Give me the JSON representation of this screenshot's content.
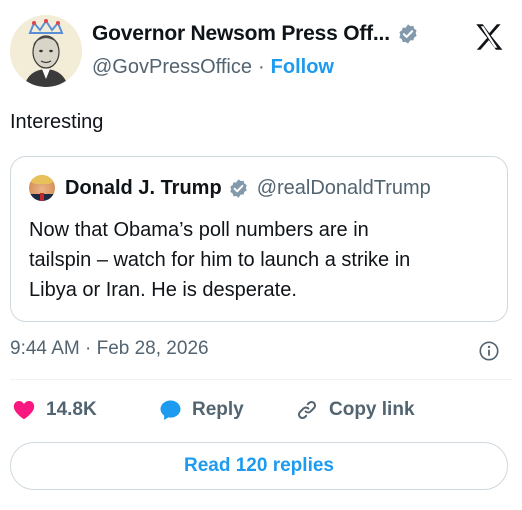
{
  "author": {
    "name": "Governor Newsom Press Off...",
    "handle": "@GovPressOffice",
    "separator": "·",
    "follow_label": "Follow"
  },
  "tweet": {
    "text": "Interesting",
    "timestamp": "9:44 AM · Feb 28, 2026"
  },
  "quoted_tweet": {
    "name": "Donald J. Trump",
    "handle": "@realDonaldTrump",
    "text": "Now that Obama’s poll numbers are in\ntailspin – watch for him to launch a strike in\nLibya or Iran.  He is desperate."
  },
  "actions": {
    "like_count": "14.8K",
    "reply_label": "Reply",
    "copy_link_label": "Copy link",
    "read_replies_label": "Read 120 replies"
  },
  "icons": {
    "verified": "verified-badge-icon",
    "x_logo": "x-logo-icon",
    "info": "info-icon",
    "heart": "heart-icon",
    "reply": "reply-bubble-icon",
    "link": "link-icon"
  },
  "colors": {
    "accent": "#1d9bf0",
    "like": "#f91880",
    "text": "#0f1419",
    "muted": "#536471",
    "border": "#cfd9de",
    "verified_gray": "#829aab"
  }
}
